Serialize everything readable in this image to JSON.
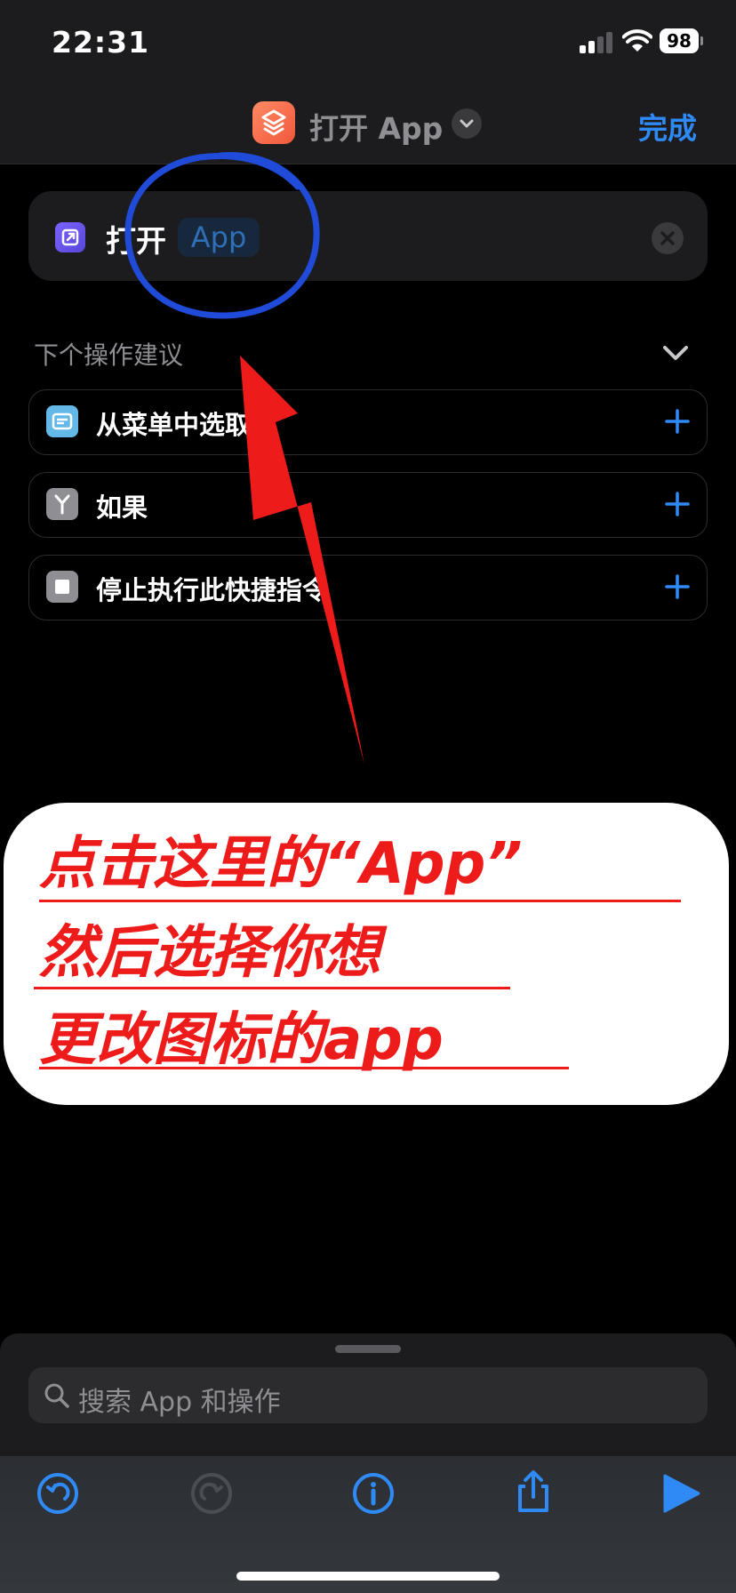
{
  "status_bar": {
    "time": "22:31",
    "battery": "98",
    "icons": [
      "cellular-signal-icon",
      "wifi-icon",
      "battery-icon"
    ]
  },
  "nav": {
    "title": "打开 App",
    "done": "完成",
    "icons": [
      "shortcuts-icon",
      "chevron-down-icon"
    ]
  },
  "action": {
    "verb": "打开",
    "param_token": "App",
    "icons": [
      "open-app-icon",
      "clear-icon"
    ]
  },
  "suggestions": {
    "header": "下个操作建议",
    "items": [
      {
        "label": "从菜单中选取",
        "icon": "menu-icon",
        "icon_color": "#63b8e8"
      },
      {
        "label": "如果",
        "icon": "branch-icon",
        "icon_color": "#8e8e93"
      },
      {
        "label": "停止执行此快捷指令",
        "icon": "stop-icon",
        "icon_color": "#8e8e93"
      }
    ]
  },
  "annotation": {
    "lines": [
      "点击这里的“App”",
      "然后选择你想",
      "更改图标的app"
    ],
    "color": "#ee1b1b",
    "circle_color": "#1f4bd8"
  },
  "bottom_sheet": {
    "search_placeholder": "搜索 App 和操作"
  },
  "toolbar": {
    "icons": [
      "undo-icon",
      "redo-icon",
      "info-icon",
      "share-icon",
      "play-icon"
    ]
  },
  "colors": {
    "accent": "#2f8af5",
    "background": "#000000",
    "surface": "#1c1c1e"
  }
}
